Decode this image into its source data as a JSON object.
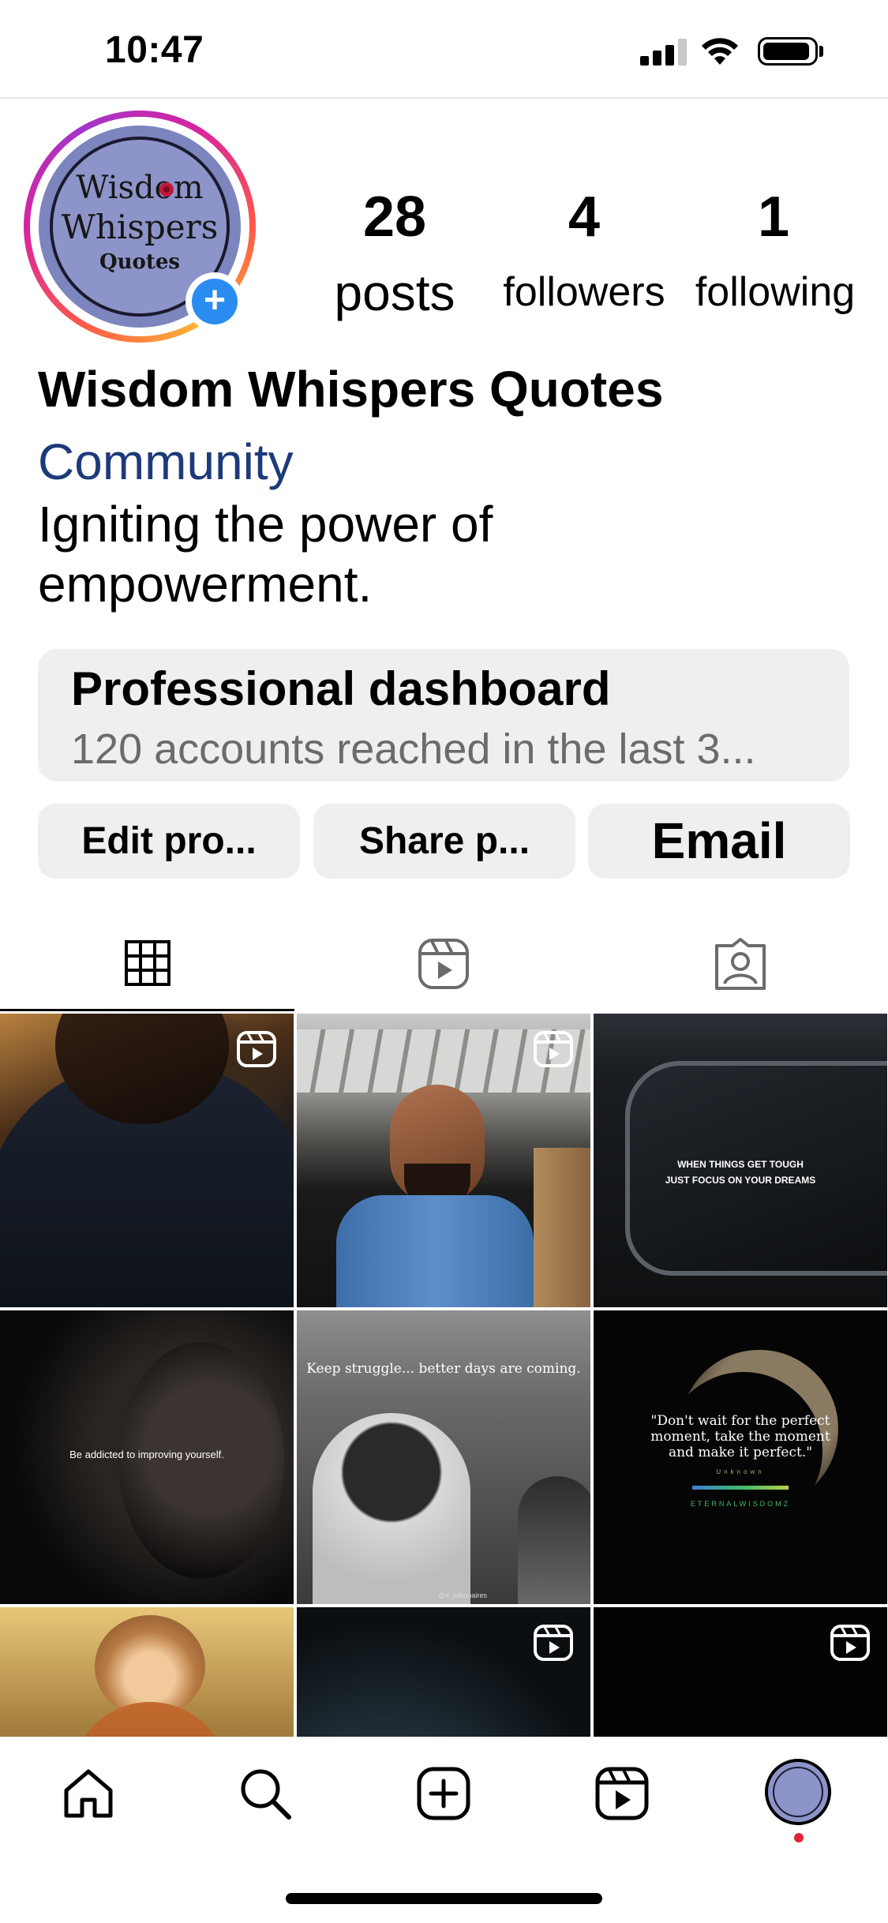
{
  "status_bar": {
    "time": "10:47"
  },
  "profile": {
    "avatar_logo": {
      "line1": "Wisdom",
      "line2": "Whispers",
      "line3": "Quotes"
    },
    "stats": [
      {
        "value": "28",
        "label": "posts"
      },
      {
        "value": "4",
        "label": "followers"
      },
      {
        "value": "1",
        "label": "following"
      }
    ],
    "name": "Wisdom Whispers Quotes",
    "category": "Community",
    "bio": "Igniting the power of empowerment.",
    "dashboard": {
      "title": "Professional dashboard",
      "subtitle": "120 accounts reached in the last 3..."
    },
    "buttons": {
      "edit": "Edit pro...",
      "share": "Share p...",
      "email": "Email"
    }
  },
  "tabs": [
    "grid-tab",
    "reels-tab",
    "tagged-tab"
  ],
  "grid": {
    "posts": [
      {
        "id": "post-1",
        "kind": "reel",
        "caption": ""
      },
      {
        "id": "post-2",
        "kind": "reel",
        "caption": ""
      },
      {
        "id": "post-3",
        "kind": "photo",
        "caption_line1": "WHEN THINGS GET TOUGH",
        "caption_line2": "JUST FOCUS ON YOUR DREAMS"
      },
      {
        "id": "post-4",
        "kind": "photo",
        "caption": "Be addicted to improving yourself."
      },
      {
        "id": "post-5",
        "kind": "photo",
        "caption": "Keep struggle... better days are coming.",
        "watermark": "@4_billionaires"
      },
      {
        "id": "post-6",
        "kind": "photo",
        "quote_line1": "\"Don't wait for the perfect",
        "quote_line2": "moment, take the moment",
        "quote_line3": "and make it perfect.\"",
        "attribution": "Unknown",
        "brand": "ETERNALWISDOMZ"
      },
      {
        "id": "post-7",
        "kind": "photo",
        "caption": ""
      },
      {
        "id": "post-8",
        "kind": "reel",
        "caption": ""
      },
      {
        "id": "post-9",
        "kind": "reel",
        "caption": ""
      }
    ]
  },
  "colors": {
    "category_link": "#1d3a7a",
    "add_story_blue": "#2a8cf0",
    "notification_dot": "#e0243a",
    "pill_background": "#efefef"
  },
  "bottom_nav": [
    "home-icon",
    "search-icon",
    "create-icon",
    "reels-icon",
    "profile-avatar"
  ]
}
